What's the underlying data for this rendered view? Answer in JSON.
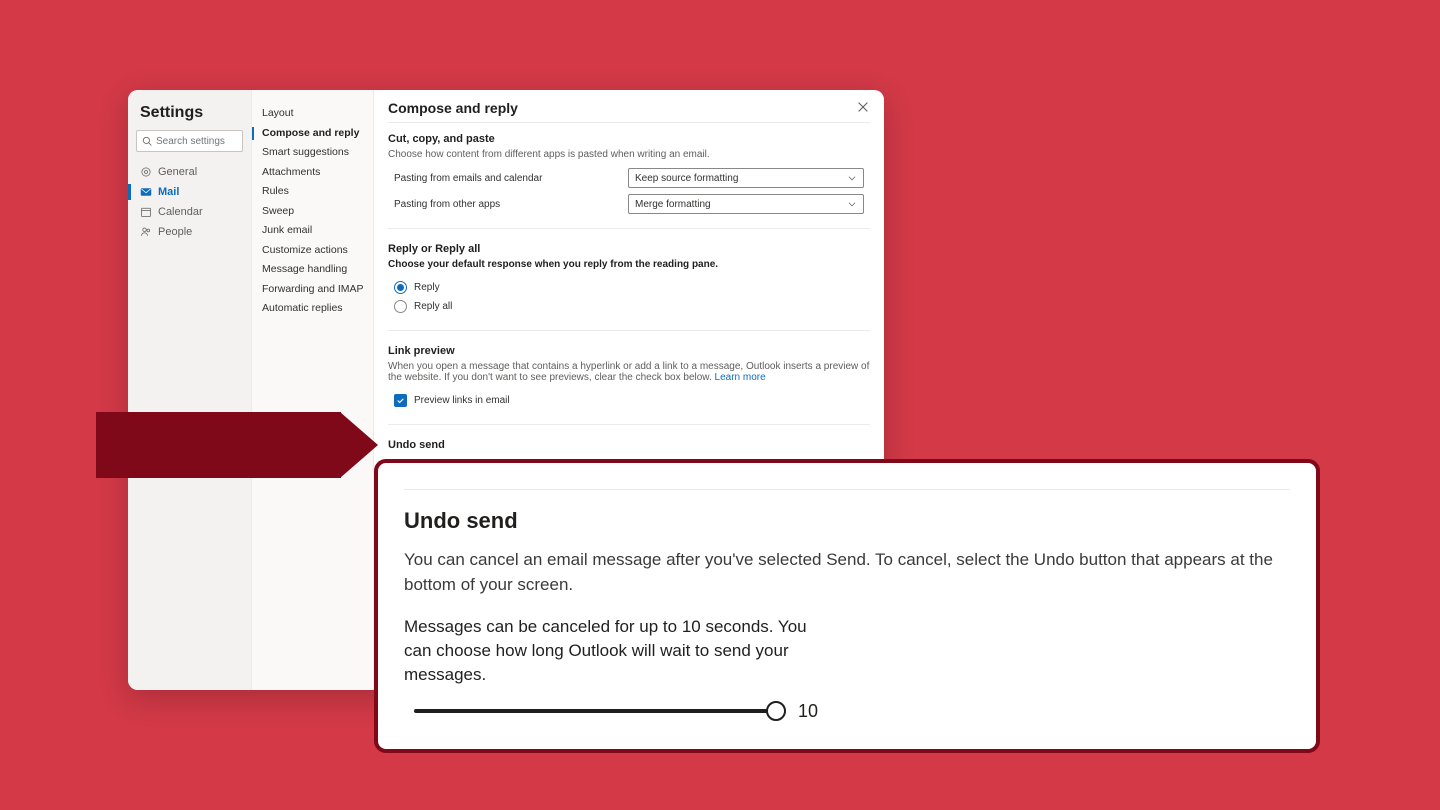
{
  "dialog": {
    "title": "Settings",
    "search_placeholder": "Search settings",
    "panel_title": "Compose and reply"
  },
  "left_nav": [
    {
      "key": "general",
      "label": "General",
      "active": false
    },
    {
      "key": "mail",
      "label": "Mail",
      "active": true
    },
    {
      "key": "calendar",
      "label": "Calendar",
      "active": false
    },
    {
      "key": "people",
      "label": "People",
      "active": false
    }
  ],
  "mid_nav": [
    {
      "label": "Layout",
      "active": false
    },
    {
      "label": "Compose and reply",
      "active": true
    },
    {
      "label": "Smart suggestions",
      "active": false
    },
    {
      "label": "Attachments",
      "active": false
    },
    {
      "label": "Rules",
      "active": false
    },
    {
      "label": "Sweep",
      "active": false
    },
    {
      "label": "Junk email",
      "active": false
    },
    {
      "label": "Customize actions",
      "active": false
    },
    {
      "label": "Message handling",
      "active": false
    },
    {
      "label": "Forwarding and IMAP",
      "active": false
    },
    {
      "label": "Automatic replies",
      "active": false
    }
  ],
  "cut_copy_paste": {
    "heading": "Cut, copy, and paste",
    "desc": "Choose how content from different apps is pasted when writing an email.",
    "row1_label": "Pasting from emails and calendar",
    "row1_value": "Keep source formatting",
    "row2_label": "Pasting from other apps",
    "row2_value": "Merge formatting"
  },
  "reply_section": {
    "heading": "Reply or Reply all",
    "desc": "Choose your default response when you reply from the reading pane.",
    "opt_reply": "Reply",
    "opt_reply_all": "Reply all"
  },
  "link_preview": {
    "heading": "Link preview",
    "desc": "When you open a message that contains a hyperlink or add a link to a message, Outlook inserts a preview of the website. If you don't want to see previews, clear the check box below. ",
    "learn_more": "Learn more",
    "checkbox_label": "Preview links in email"
  },
  "undo_small": {
    "heading": "Undo send"
  },
  "callout": {
    "heading": "Undo send",
    "desc": "You can cancel an email message after you've selected Send. To cancel, select the Undo button that appears at the bottom of your screen.",
    "sub": "Messages can be canceled for up to 10 seconds. You can choose how long Outlook will wait to send your messages.",
    "slider_value": "10"
  }
}
